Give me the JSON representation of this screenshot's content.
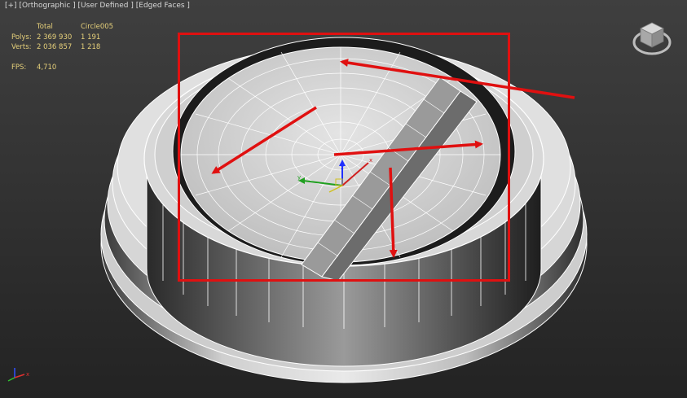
{
  "viewport": {
    "labels": [
      "[+]",
      "[Orthographic ]",
      "[User Defined ]",
      "[Edged Faces ]"
    ]
  },
  "stats": {
    "header": {
      "label": "",
      "total": "Total",
      "selected": "Circle005"
    },
    "polys": {
      "label": "Polys:",
      "total": "2 369 930",
      "selected": "1 191"
    },
    "verts": {
      "label": "Verts:",
      "total": "2 036 857",
      "selected": "1 218"
    },
    "fps": {
      "label": "FPS:",
      "value": "4,710"
    }
  },
  "icons": [
    "viewcube-icon",
    "transform-gizmo-icon",
    "world-axis-icon"
  ],
  "colors": {
    "annotation": "#e01010",
    "stats_text": "#e6d07a",
    "mesh_surface": "#d9d9d9",
    "wire": "#ffffff"
  }
}
